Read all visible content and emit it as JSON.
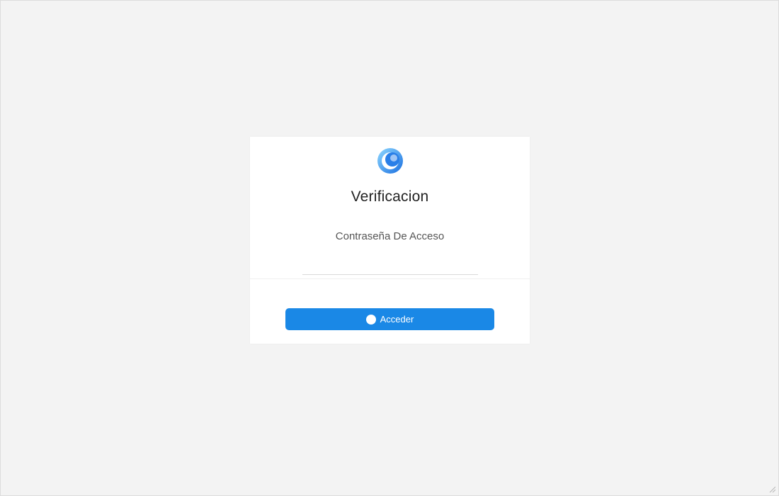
{
  "form": {
    "title": "Verificacion",
    "field_label": "Contraseña De Acceso",
    "password_value": "",
    "password_placeholder": "",
    "submit_label": "Acceder"
  },
  "colors": {
    "background": "#f3f3f3",
    "card": "#ffffff",
    "accent": "#1a88e6",
    "logo_light": "#6ec6f5",
    "logo_dark": "#1a6fe0"
  },
  "icons": {
    "logo": "circular-arrow-logo-icon",
    "submit": "lock-icon",
    "resize": "resize-grip-icon"
  }
}
